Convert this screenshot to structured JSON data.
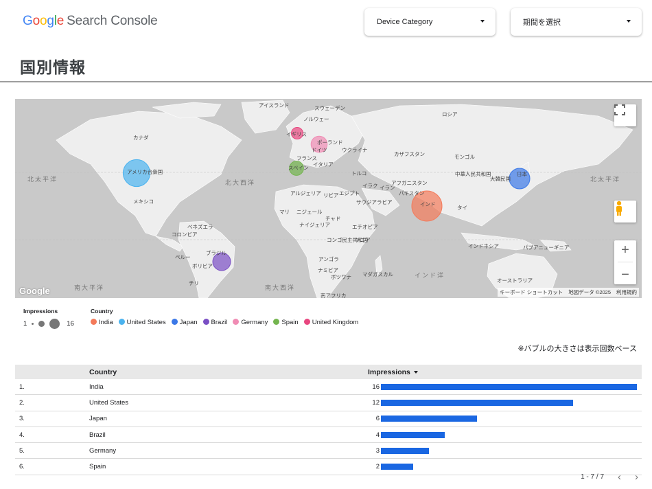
{
  "header": {
    "logo_google": "Google",
    "logo_product": "Search Console",
    "device_dropdown": "Device Category",
    "period_dropdown": "期間を選択"
  },
  "page_title": "国別情報",
  "map": {
    "labels": [
      {
        "text": "アイスランド"
      },
      {
        "text": "スウェーデン"
      },
      {
        "text": "ノルウェー"
      },
      {
        "text": "ロシア"
      },
      {
        "text": "カナダ"
      },
      {
        "text": "イギリス"
      },
      {
        "text": "ポーランド"
      },
      {
        "text": "ドイツ"
      },
      {
        "text": "ウクライナ"
      },
      {
        "text": "フランス"
      },
      {
        "text": "カザフスタン"
      },
      {
        "text": "モンゴル"
      },
      {
        "text": "イタリア"
      },
      {
        "text": "スペイン"
      },
      {
        "text": "トルコ"
      },
      {
        "text": "アメリカ合衆国"
      },
      {
        "text": "中華人民共和国"
      },
      {
        "text": "日本"
      },
      {
        "text": "大韓民国"
      },
      {
        "text": "イラク"
      },
      {
        "text": "イラン"
      },
      {
        "text": "アフガニスタン"
      },
      {
        "text": "パキスタン"
      },
      {
        "text": "アルジェリア"
      },
      {
        "text": "リビア"
      },
      {
        "text": "エジプト"
      },
      {
        "text": "サウジアラビア"
      },
      {
        "text": "インド"
      },
      {
        "text": "メキシコ"
      },
      {
        "text": "タイ"
      },
      {
        "text": "マリ"
      },
      {
        "text": "ニジェール"
      },
      {
        "text": "チャド"
      },
      {
        "text": "ナイジェリア"
      },
      {
        "text": "エチオピア"
      },
      {
        "text": "ベネズエラ"
      },
      {
        "text": "コロンビア"
      },
      {
        "text": "コンゴ民主共和国"
      },
      {
        "text": "ケニア"
      },
      {
        "text": "インドネシア"
      },
      {
        "text": "パプアニューギニア"
      },
      {
        "text": "ペルー"
      },
      {
        "text": "ブラジル"
      },
      {
        "text": "ボリビア"
      },
      {
        "text": "アンゴラ"
      },
      {
        "text": "ナミビア"
      },
      {
        "text": "ボツワナ"
      },
      {
        "text": "マダガスカル"
      },
      {
        "text": "オーストラリア"
      },
      {
        "text": "チリ"
      },
      {
        "text": "南アフリカ"
      }
    ],
    "seas": [
      {
        "text": "北太平洋"
      },
      {
        "text": "北大西洋"
      },
      {
        "text": "北太平洋"
      },
      {
        "text": "南大平洋"
      },
      {
        "text": "南大西洋"
      },
      {
        "text": "インド洋"
      }
    ],
    "watermark": "Google",
    "attribution": [
      "キーボード ショートカット",
      "地図データ ©2025",
      "利用規約"
    ],
    "bubble_colors": {
      "India": "#f47a5a",
      "United States": "#4bb3ef",
      "Japan": "#3b78e7",
      "Brazil": "#7a4fc4",
      "Germany": "#f08cb4",
      "Spain": "#74b54f",
      "United Kingdom": "#e8467f"
    }
  },
  "legend": {
    "impressions_title": "Impressions",
    "min": "1",
    "max": "16",
    "country_title": "Country",
    "countries": [
      "India",
      "United States",
      "Japan",
      "Brazil",
      "Germany",
      "Spain",
      "United Kingdom"
    ]
  },
  "note": "※バブルの大きさは表示回数ベース",
  "table": {
    "col_country": "Country",
    "col_impressions": "Impressions",
    "max_value": 16,
    "rows": [
      {
        "idx": "1.",
        "country": "India",
        "value": 16
      },
      {
        "idx": "2.",
        "country": "United States",
        "value": 12
      },
      {
        "idx": "3.",
        "country": "Japan",
        "value": 6
      },
      {
        "idx": "4.",
        "country": "Brazil",
        "value": 4
      },
      {
        "idx": "5.",
        "country": "Germany",
        "value": 3
      },
      {
        "idx": "6.",
        "country": "Spain",
        "value": 2
      }
    ]
  },
  "pager": {
    "range": "1 - 7 / 7"
  }
}
